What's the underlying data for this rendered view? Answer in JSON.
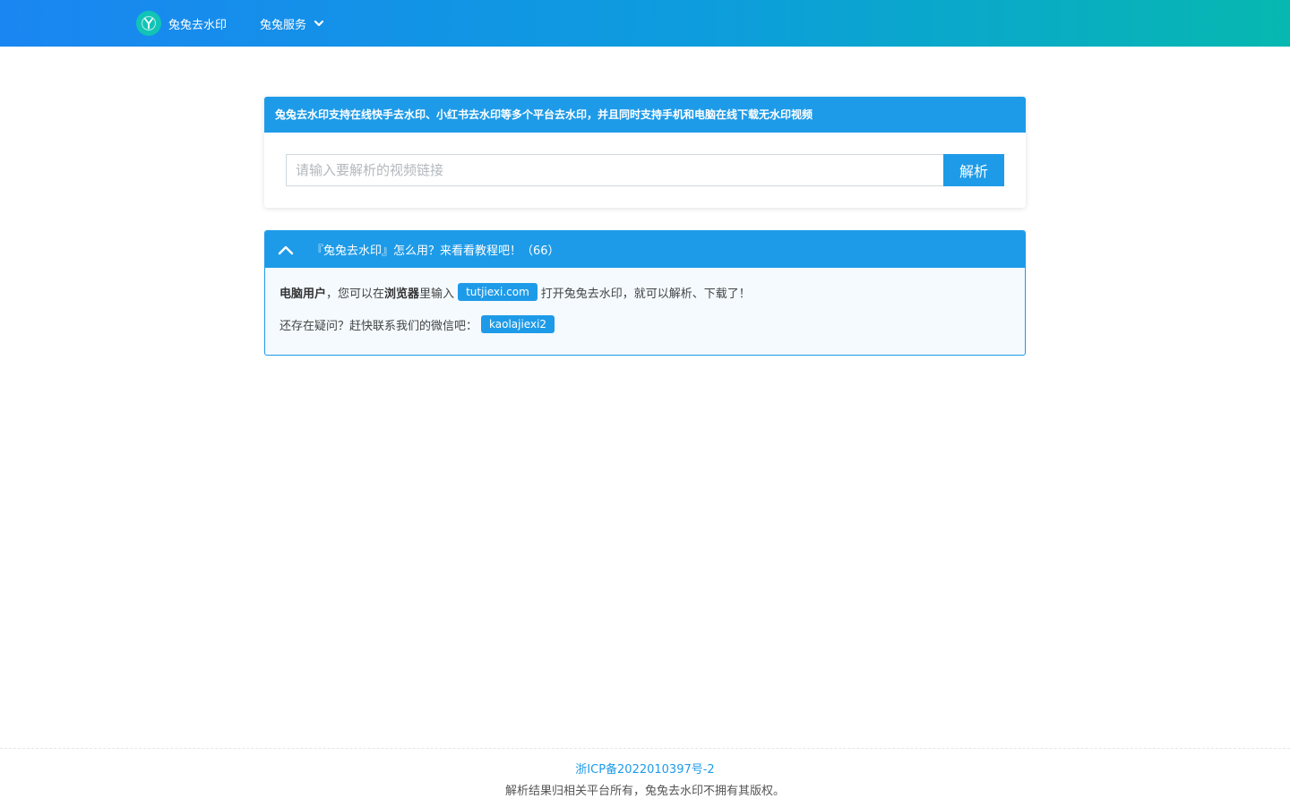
{
  "header": {
    "logo_icon": "y-letter-logo-icon",
    "brand_name": "兔兔去水印",
    "menu_label": "兔兔服务",
    "menu_icon": "chevron-down-icon"
  },
  "main_card": {
    "title": "兔兔去水印支持在线快手去水印、小红书去水印等多个平台去水印，并且同时支持手机和电脑在线下载无水印视频",
    "input_placeholder": "请输入要解析的视频链接",
    "input_value": "",
    "button_label": "解析"
  },
  "tutorial": {
    "toggle_icon": "chevron-up-icon",
    "title": "『兔兔去水印』怎么用？来看看教程吧！（66）",
    "line1": {
      "bold1": "电脑用户",
      "text1": "，您可以在",
      "bold2": "浏览器",
      "text2": "里输入",
      "tag": "tutjiexi.com",
      "text3": "打开兔兔去水印，就可以解析、下载了！"
    },
    "line2": {
      "text": "还存在疑问？赶快联系我们的微信吧：",
      "tag": "kaolajiexi2"
    }
  },
  "footer": {
    "icp": "浙ICP备2022010397号-2",
    "copyright": "解析结果归相关平台所有，兔兔去水印不拥有其版权。"
  },
  "colors": {
    "primary": "#1e9be8",
    "gradient_start": "#1a86f2",
    "gradient_end": "#06b8b0",
    "logo": "#11c4b6"
  }
}
